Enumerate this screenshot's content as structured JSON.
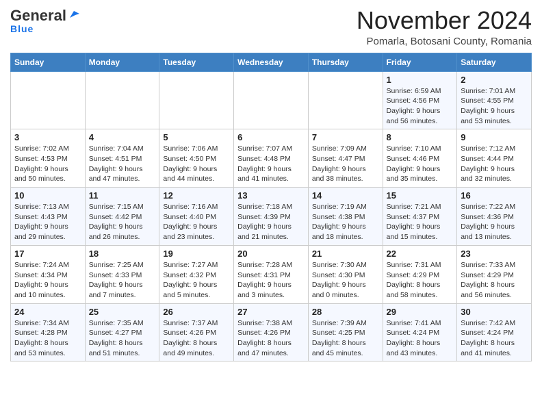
{
  "header": {
    "logo_general": "General",
    "logo_blue": "Blue",
    "month_title": "November 2024",
    "location": "Pomarla, Botosani County, Romania"
  },
  "weekdays": [
    "Sunday",
    "Monday",
    "Tuesday",
    "Wednesday",
    "Thursday",
    "Friday",
    "Saturday"
  ],
  "weeks": [
    [
      {
        "day": "",
        "info": ""
      },
      {
        "day": "",
        "info": ""
      },
      {
        "day": "",
        "info": ""
      },
      {
        "day": "",
        "info": ""
      },
      {
        "day": "",
        "info": ""
      },
      {
        "day": "1",
        "info": "Sunrise: 6:59 AM\nSunset: 4:56 PM\nDaylight: 9 hours and 56 minutes."
      },
      {
        "day": "2",
        "info": "Sunrise: 7:01 AM\nSunset: 4:55 PM\nDaylight: 9 hours and 53 minutes."
      }
    ],
    [
      {
        "day": "3",
        "info": "Sunrise: 7:02 AM\nSunset: 4:53 PM\nDaylight: 9 hours and 50 minutes."
      },
      {
        "day": "4",
        "info": "Sunrise: 7:04 AM\nSunset: 4:51 PM\nDaylight: 9 hours and 47 minutes."
      },
      {
        "day": "5",
        "info": "Sunrise: 7:06 AM\nSunset: 4:50 PM\nDaylight: 9 hours and 44 minutes."
      },
      {
        "day": "6",
        "info": "Sunrise: 7:07 AM\nSunset: 4:48 PM\nDaylight: 9 hours and 41 minutes."
      },
      {
        "day": "7",
        "info": "Sunrise: 7:09 AM\nSunset: 4:47 PM\nDaylight: 9 hours and 38 minutes."
      },
      {
        "day": "8",
        "info": "Sunrise: 7:10 AM\nSunset: 4:46 PM\nDaylight: 9 hours and 35 minutes."
      },
      {
        "day": "9",
        "info": "Sunrise: 7:12 AM\nSunset: 4:44 PM\nDaylight: 9 hours and 32 minutes."
      }
    ],
    [
      {
        "day": "10",
        "info": "Sunrise: 7:13 AM\nSunset: 4:43 PM\nDaylight: 9 hours and 29 minutes."
      },
      {
        "day": "11",
        "info": "Sunrise: 7:15 AM\nSunset: 4:42 PM\nDaylight: 9 hours and 26 minutes."
      },
      {
        "day": "12",
        "info": "Sunrise: 7:16 AM\nSunset: 4:40 PM\nDaylight: 9 hours and 23 minutes."
      },
      {
        "day": "13",
        "info": "Sunrise: 7:18 AM\nSunset: 4:39 PM\nDaylight: 9 hours and 21 minutes."
      },
      {
        "day": "14",
        "info": "Sunrise: 7:19 AM\nSunset: 4:38 PM\nDaylight: 9 hours and 18 minutes."
      },
      {
        "day": "15",
        "info": "Sunrise: 7:21 AM\nSunset: 4:37 PM\nDaylight: 9 hours and 15 minutes."
      },
      {
        "day": "16",
        "info": "Sunrise: 7:22 AM\nSunset: 4:36 PM\nDaylight: 9 hours and 13 minutes."
      }
    ],
    [
      {
        "day": "17",
        "info": "Sunrise: 7:24 AM\nSunset: 4:34 PM\nDaylight: 9 hours and 10 minutes."
      },
      {
        "day": "18",
        "info": "Sunrise: 7:25 AM\nSunset: 4:33 PM\nDaylight: 9 hours and 7 minutes."
      },
      {
        "day": "19",
        "info": "Sunrise: 7:27 AM\nSunset: 4:32 PM\nDaylight: 9 hours and 5 minutes."
      },
      {
        "day": "20",
        "info": "Sunrise: 7:28 AM\nSunset: 4:31 PM\nDaylight: 9 hours and 3 minutes."
      },
      {
        "day": "21",
        "info": "Sunrise: 7:30 AM\nSunset: 4:30 PM\nDaylight: 9 hours and 0 minutes."
      },
      {
        "day": "22",
        "info": "Sunrise: 7:31 AM\nSunset: 4:29 PM\nDaylight: 8 hours and 58 minutes."
      },
      {
        "day": "23",
        "info": "Sunrise: 7:33 AM\nSunset: 4:29 PM\nDaylight: 8 hours and 56 minutes."
      }
    ],
    [
      {
        "day": "24",
        "info": "Sunrise: 7:34 AM\nSunset: 4:28 PM\nDaylight: 8 hours and 53 minutes."
      },
      {
        "day": "25",
        "info": "Sunrise: 7:35 AM\nSunset: 4:27 PM\nDaylight: 8 hours and 51 minutes."
      },
      {
        "day": "26",
        "info": "Sunrise: 7:37 AM\nSunset: 4:26 PM\nDaylight: 8 hours and 49 minutes."
      },
      {
        "day": "27",
        "info": "Sunrise: 7:38 AM\nSunset: 4:26 PM\nDaylight: 8 hours and 47 minutes."
      },
      {
        "day": "28",
        "info": "Sunrise: 7:39 AM\nSunset: 4:25 PM\nDaylight: 8 hours and 45 minutes."
      },
      {
        "day": "29",
        "info": "Sunrise: 7:41 AM\nSunset: 4:24 PM\nDaylight: 8 hours and 43 minutes."
      },
      {
        "day": "30",
        "info": "Sunrise: 7:42 AM\nSunset: 4:24 PM\nDaylight: 8 hours and 41 minutes."
      }
    ]
  ]
}
